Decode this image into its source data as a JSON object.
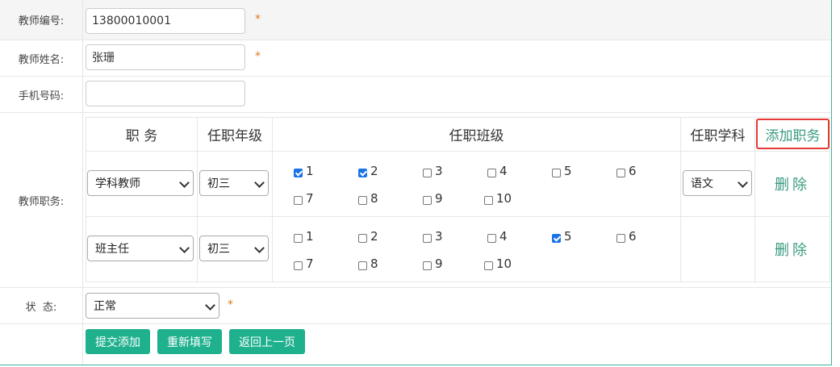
{
  "fields": {
    "teacher_id": {
      "label": "教师编号:",
      "value": "13800010001",
      "required_mark": "*"
    },
    "teacher_name": {
      "label": "教师姓名:",
      "value": "张珊",
      "required_mark": "*"
    },
    "phone": {
      "label": "手机号码:",
      "value": ""
    },
    "duties_label": "教师职务:",
    "status": {
      "label": "状  态:",
      "value": "正常",
      "required_mark": "*"
    }
  },
  "duty_table": {
    "headers": {
      "position": "职  务",
      "grade": "任职年级",
      "classes": "任职班级",
      "subject": "任职学科",
      "add": "添加职务"
    },
    "rows": [
      {
        "position": "学科教师",
        "grade": "初三",
        "subject": "语文",
        "delete": "删除",
        "classes": [
          {
            "label": "1",
            "checked": true
          },
          {
            "label": "2",
            "checked": true
          },
          {
            "label": "3",
            "checked": false
          },
          {
            "label": "4",
            "checked": false
          },
          {
            "label": "5",
            "checked": false
          },
          {
            "label": "6",
            "checked": false
          },
          {
            "label": "7",
            "checked": false
          },
          {
            "label": "8",
            "checked": false
          },
          {
            "label": "9",
            "checked": false
          },
          {
            "label": "10",
            "checked": false
          }
        ]
      },
      {
        "position": "班主任",
        "grade": "初三",
        "subject": "",
        "delete": "删除",
        "classes": [
          {
            "label": "1",
            "checked": false
          },
          {
            "label": "2",
            "checked": false
          },
          {
            "label": "3",
            "checked": false
          },
          {
            "label": "4",
            "checked": false
          },
          {
            "label": "5",
            "checked": true
          },
          {
            "label": "6",
            "checked": false
          },
          {
            "label": "7",
            "checked": false
          },
          {
            "label": "8",
            "checked": false
          },
          {
            "label": "9",
            "checked": false
          },
          {
            "label": "10",
            "checked": false
          }
        ]
      }
    ]
  },
  "buttons": {
    "submit": "提交添加",
    "reset": "重新填写",
    "back": "返回上一页"
  },
  "colors": {
    "accent": "#1fb08e",
    "link": "#3a9a80",
    "required": "#e07b1a",
    "highlight_border": "#e53935"
  }
}
